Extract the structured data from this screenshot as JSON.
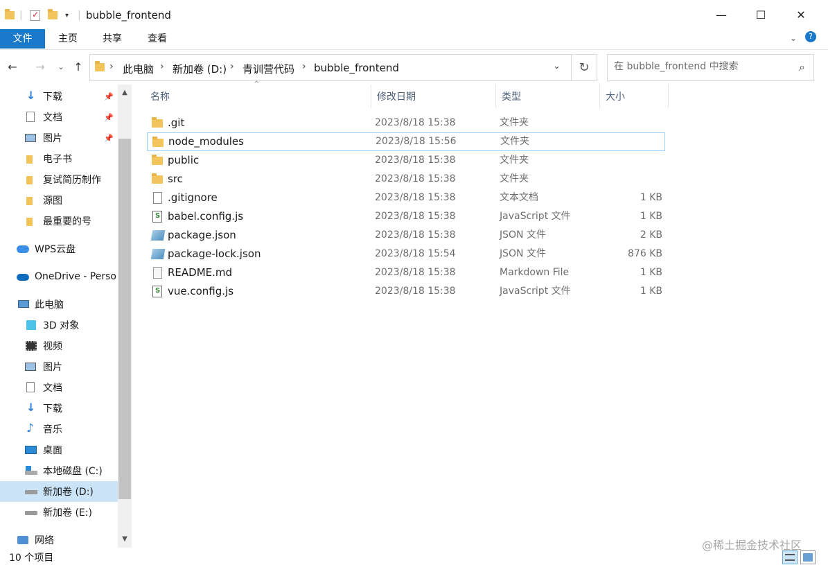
{
  "window": {
    "title": "bubble_frontend"
  },
  "ribbon": {
    "tabs": [
      "文件",
      "主页",
      "共享",
      "查看"
    ]
  },
  "address": {
    "crumbs": [
      "此电脑",
      "新加卷 (D:)",
      "青训营代码",
      "bubble_frontend"
    ]
  },
  "search": {
    "placeholder": "在 bubble_frontend 中搜索"
  },
  "sidebar": {
    "items": [
      {
        "label": "下载",
        "icon": "download-icon",
        "pinned": true
      },
      {
        "label": "文档",
        "icon": "document-icon",
        "pinned": true
      },
      {
        "label": "图片",
        "icon": "picture-icon",
        "pinned": true
      },
      {
        "label": "电子书",
        "icon": "folder-icon"
      },
      {
        "label": "复试简历制作",
        "icon": "folder-icon"
      },
      {
        "label": "源图",
        "icon": "folder-icon"
      },
      {
        "label": "最重要的号",
        "icon": "folder-icon"
      },
      {
        "label": "WPS云盘",
        "icon": "cloud-icon"
      },
      {
        "label": "OneDrive - Perso",
        "icon": "onedrive-icon"
      },
      {
        "label": "此电脑",
        "icon": "computer-icon"
      },
      {
        "label": "3D 对象",
        "icon": "3d-objects-icon"
      },
      {
        "label": "视频",
        "icon": "video-icon"
      },
      {
        "label": "图片",
        "icon": "picture-icon"
      },
      {
        "label": "文档",
        "icon": "document-icon"
      },
      {
        "label": "下载",
        "icon": "download-icon"
      },
      {
        "label": "音乐",
        "icon": "music-icon"
      },
      {
        "label": "桌面",
        "icon": "desktop-icon"
      },
      {
        "label": "本地磁盘 (C:)",
        "icon": "windows-drive-icon"
      },
      {
        "label": "新加卷 (D:)",
        "icon": "drive-icon"
      },
      {
        "label": "新加卷 (E:)",
        "icon": "drive-icon"
      },
      {
        "label": "网络",
        "icon": "network-icon"
      }
    ]
  },
  "columns": {
    "name": "名称",
    "date": "修改日期",
    "type": "类型",
    "size": "大小"
  },
  "files": [
    {
      "name": ".git",
      "date": "2023/8/18 15:38",
      "type": "文件夹",
      "size": "",
      "icon": "folder-icon"
    },
    {
      "name": "node_modules",
      "date": "2023/8/18 15:56",
      "type": "文件夹",
      "size": "",
      "icon": "folder-icon"
    },
    {
      "name": "public",
      "date": "2023/8/18 15:38",
      "type": "文件夹",
      "size": "",
      "icon": "folder-icon"
    },
    {
      "name": "src",
      "date": "2023/8/18 15:38",
      "type": "文件夹",
      "size": "",
      "icon": "folder-icon"
    },
    {
      "name": ".gitignore",
      "date": "2023/8/18 15:38",
      "type": "文本文档",
      "size": "1 KB",
      "icon": "text-file-icon"
    },
    {
      "name": "babel.config.js",
      "date": "2023/8/18 15:38",
      "type": "JavaScript 文件",
      "size": "1 KB",
      "icon": "js-file-icon"
    },
    {
      "name": "package.json",
      "date": "2023/8/18 15:38",
      "type": "JSON 文件",
      "size": "2 KB",
      "icon": "json-file-icon"
    },
    {
      "name": "package-lock.json",
      "date": "2023/8/18 15:54",
      "type": "JSON 文件",
      "size": "876 KB",
      "icon": "json-file-icon"
    },
    {
      "name": "README.md",
      "date": "2023/8/18 15:38",
      "type": "Markdown File",
      "size": "1 KB",
      "icon": "markdown-file-icon"
    },
    {
      "name": "vue.config.js",
      "date": "2023/8/18 15:38",
      "type": "JavaScript 文件",
      "size": "1 KB",
      "icon": "js-file-icon"
    }
  ],
  "status": {
    "count": "10 个项目"
  },
  "watermark": "@稀土掘金技术社区"
}
